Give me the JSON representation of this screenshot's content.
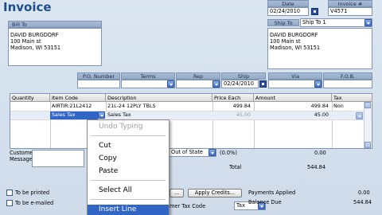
{
  "form": {
    "title": "Invoice",
    "date_header": "Date",
    "date_value": "02/24/2010",
    "invoice_header": "Invoice #",
    "invoice_value": "V4571"
  },
  "bill_to": {
    "header": "Bill To",
    "line1": "DAVID BURGDORF",
    "line2": "100 Main st",
    "line3": "Madison, WI 53151"
  },
  "ship_to": {
    "header": "Ship To",
    "selected": "Ship To 1",
    "line1": "DAVID BURGDORF",
    "line2": "100 Main st",
    "line3": "Madison, WI 53151"
  },
  "order_fields": {
    "po_header": "P.O. Number",
    "terms_header": "Terms",
    "rep_header": "Rep",
    "ship_header": "Ship",
    "ship_value": "02/24/2010",
    "via_header": "Via",
    "fob_header": "F.O.B."
  },
  "line_items": {
    "headers": [
      "Quantity",
      "Item Code",
      "Description",
      "Price Each",
      "Amount",
      "Tax"
    ],
    "rows": [
      {
        "qty": "",
        "item": "AIRTIR:21L2412",
        "desc": "21L-24 12PLY TBLS",
        "price": "499.84",
        "amount": "499.84",
        "tax": "Non"
      },
      {
        "qty": "",
        "item": "Sales Tax",
        "desc": "Sales Tax",
        "price": "45.00",
        "amount": "45.00",
        "tax": ""
      }
    ]
  },
  "context_menu": {
    "items": [
      "Undo Typing",
      "Cut",
      "Copy",
      "Paste",
      "Select All",
      "Insert Line"
    ]
  },
  "footer": {
    "customer_message_label": "Customer\nMessage",
    "tax_item": "Out of State",
    "tax_rate": "(0.0%)",
    "tax_amount": "0.00",
    "total_label": "Total",
    "total_value": "544.84",
    "to_be_printed": "To be printed",
    "to_be_emailed": "To be e-mailed",
    "apply_credits": "Apply Credits...",
    "ellipsis_button": "...",
    "customer_tax_code_label": "mer Tax Code",
    "customer_tax_code_value": "Tax",
    "payments_applied_label": "Payments Applied",
    "payments_applied_value": "0.00",
    "balance_due_label": "Balance Due",
    "balance_due_value": "544.84"
  }
}
